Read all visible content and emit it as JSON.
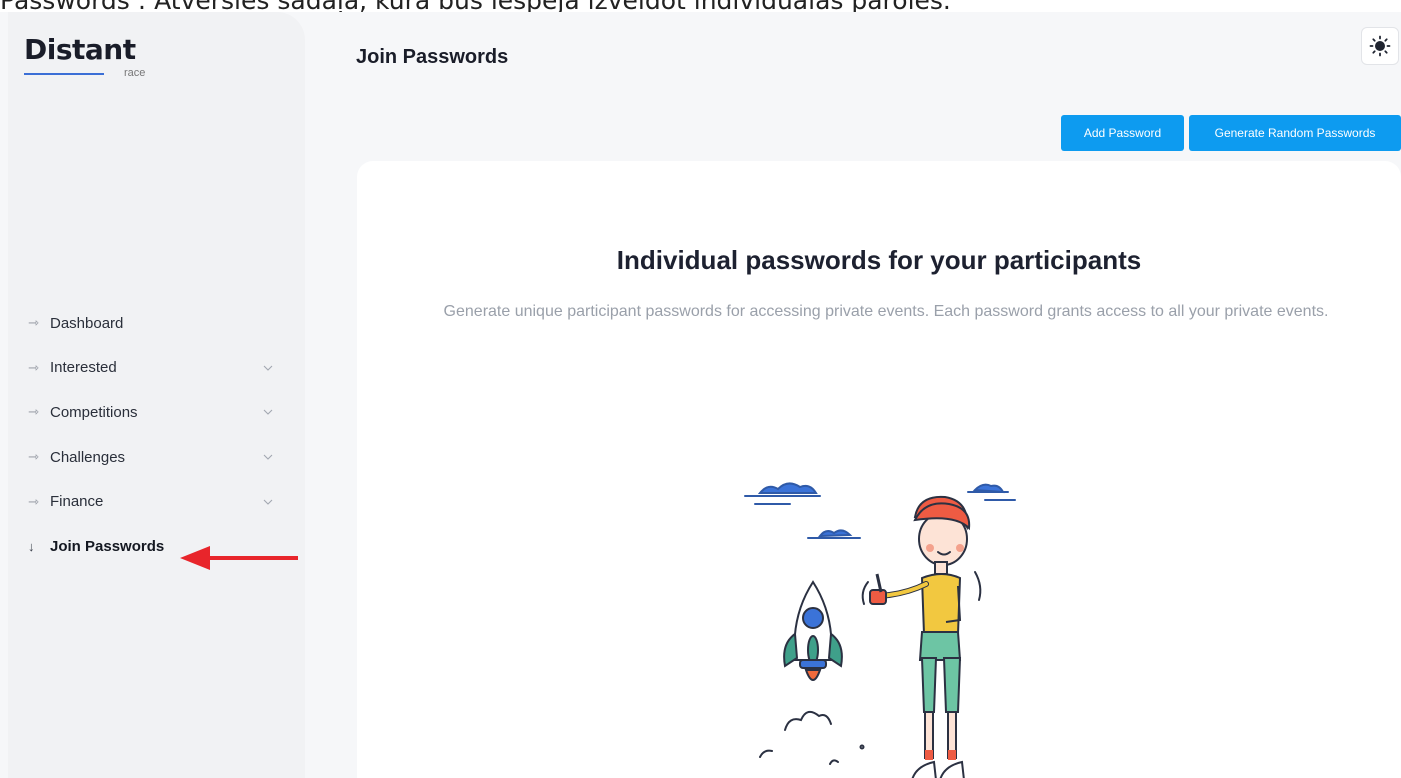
{
  "caption": "Passwords : Atvērsies sadaļa, kurā būs iespēja izveidot individuālas paroles.",
  "brand": {
    "name": "Distant",
    "subtitle": "race"
  },
  "sidebar": {
    "items": [
      {
        "label": "Dashboard",
        "icon": "arrow-right-icon",
        "has_chevron": false
      },
      {
        "label": "Interested",
        "icon": "arrow-right-icon",
        "has_chevron": true
      },
      {
        "label": "Competitions",
        "icon": "arrow-right-icon",
        "has_chevron": true
      },
      {
        "label": "Challenges",
        "icon": "arrow-right-icon",
        "has_chevron": true
      },
      {
        "label": "Finance",
        "icon": "arrow-right-icon",
        "has_chevron": true
      },
      {
        "label": "Join Passwords",
        "icon": "arrow-down-icon",
        "has_chevron": false,
        "active": true
      }
    ]
  },
  "header": {
    "title": "Join Passwords",
    "theme_icon": "sun-icon"
  },
  "actions": {
    "add_label": "Add Password",
    "generate_label": "Generate Random Passwords"
  },
  "empty_state": {
    "title": "Individual passwords for your participants",
    "description": "Generate unique participant passwords for accessing private events. Each password grants access to all your private events."
  },
  "colors": {
    "accent": "#0d9bf0",
    "annotation_arrow": "#e8252b",
    "sidebar_bg": "#f1f2f4",
    "page_bg": "#f6f7f9"
  }
}
